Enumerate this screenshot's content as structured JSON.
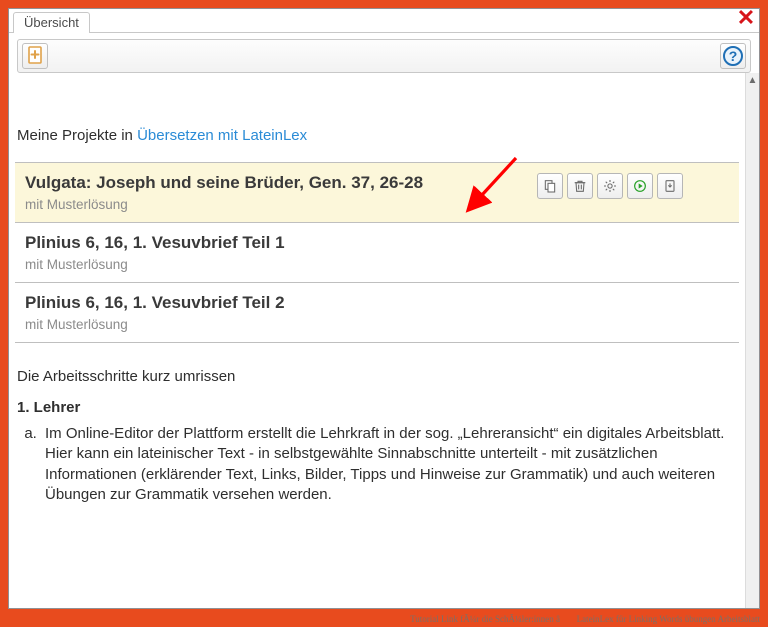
{
  "tab": {
    "label": "Übersicht"
  },
  "intro": {
    "prefix": "Meine Projekte in ",
    "link": "Übersetzen mit LateinLex"
  },
  "projects": [
    {
      "title": "Vulgata: Joseph und seine Brüder, Gen. 37, 26-28",
      "subtitle": "mit Musterlösung",
      "highlight": true,
      "actions": true
    },
    {
      "title": "Plinius 6, 16, 1. Vesuvbrief Teil 1",
      "subtitle": "mit Musterlösung",
      "highlight": false,
      "actions": false
    },
    {
      "title": "Plinius 6, 16, 1. Vesuvbrief Teil 2",
      "subtitle": "mit Musterlösung",
      "highlight": false,
      "actions": false
    }
  ],
  "instructions": {
    "heading": "Die Arbeitsschritte kurz umrissen",
    "step_label": "1. Lehrer",
    "step_a": "Im Online-Editor der Plattform erstellt die Lehrkraft in der sog. „Lehreransicht“ ein digitales Arbeitsblatt. Hier kann ein lateinischer Text - in selbstgewählte Sinnabschnitte unterteilt - mit zusätzlichen Informationen (erklärender Text, Links, Bilder, Tipps und Hinweise zur Grammatik) und auch weiteren Übungen zur Grammatik versehen werden."
  },
  "caption": "Tutorial Link fÃ¼r die SchÃ¼ler:innen â LateinLex für Linking Words übungen Arbeitsblatt"
}
